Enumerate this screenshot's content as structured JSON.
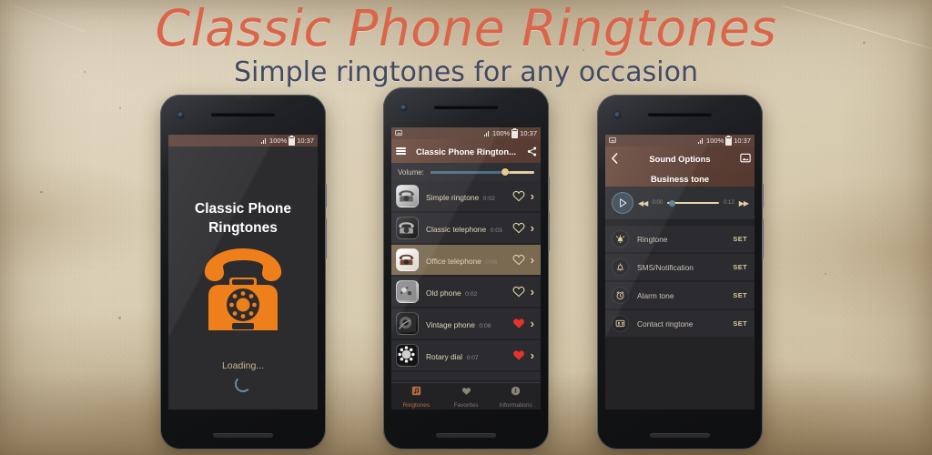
{
  "header": {
    "title": "Classic Phone Ringtones",
    "subtitle": "Simple ringtones for any occasion",
    "title_color": "#d9654a",
    "subtitle_color": "#424a63"
  },
  "status_bar": {
    "battery": "100%",
    "time": "10:37",
    "signal_icon": "signal-bars-icon",
    "battery_icon": "battery-icon"
  },
  "phone1": {
    "app_name_line1": "Classic Phone",
    "app_name_line2": "Ringtones",
    "logo_icon": "rotary-telephone-icon",
    "logo_color": "#ef7f1a",
    "loading_text": "Loading...",
    "spinner_icon": "loading-spinner-icon"
  },
  "phone2": {
    "menu_icon": "hamburger-menu-icon",
    "toolbar_title": "Classic Phone Rington...",
    "share_icon": "share-icon",
    "gallery_icon": "image-icon",
    "volume_label": "Volume:",
    "volume_percent": 72,
    "ringtones": [
      {
        "name": "Simple ringtone",
        "duration": "0:02",
        "favorite": false,
        "thumb": "white-telephone-icon",
        "selected": false
      },
      {
        "name": "Classic telephone",
        "duration": "0:03",
        "favorite": false,
        "thumb": "black-telephone-icon",
        "selected": false
      },
      {
        "name": "Office telephone",
        "duration": "0:06",
        "favorite": false,
        "thumb": "office-telephone-icon",
        "selected": true
      },
      {
        "name": "Old phone",
        "duration": "0:02",
        "favorite": false,
        "thumb": "old-phone-icon",
        "selected": false
      },
      {
        "name": "Vintage phone",
        "duration": "0:06",
        "favorite": true,
        "thumb": "vintage-phone-icon",
        "selected": false
      },
      {
        "name": "Rotary dial",
        "duration": "0:07",
        "favorite": true,
        "thumb": "rotary-dial-icon",
        "selected": false
      }
    ],
    "bottom_nav": [
      {
        "label": "Ringtones",
        "icon": "ringtone-icon",
        "active": true
      },
      {
        "label": "Favorites",
        "icon": "heart-icon",
        "active": false
      },
      {
        "label": "Informations",
        "icon": "information-icon",
        "active": false
      }
    ]
  },
  "phone3": {
    "back_icon": "back-chevron-icon",
    "toolbar_title": "Sound Options",
    "gallery_icon": "image-icon",
    "tone_name": "Business tone",
    "play_icon": "play-icon",
    "rewind_icon": "rewind-icon",
    "forward_icon": "fast-forward-icon",
    "time_current": "0:00",
    "time_total": "0:12",
    "progress_percent": 3,
    "options": [
      {
        "label": "Ringtone",
        "icon": "ringtone-bell-icon",
        "action": "SET"
      },
      {
        "label": "SMS/Notification",
        "icon": "notification-bell-icon",
        "action": "SET"
      },
      {
        "label": "Alarm tone",
        "icon": "alarm-clock-icon",
        "action": "SET"
      },
      {
        "label": "Contact ringtone",
        "icon": "contact-card-icon",
        "action": "SET"
      }
    ]
  },
  "colors": {
    "accent_orange": "#ef7f1a",
    "toolbar_brown": "#5d4036",
    "favorite_red": "#e8332a",
    "gold": "#e3cd9e"
  }
}
